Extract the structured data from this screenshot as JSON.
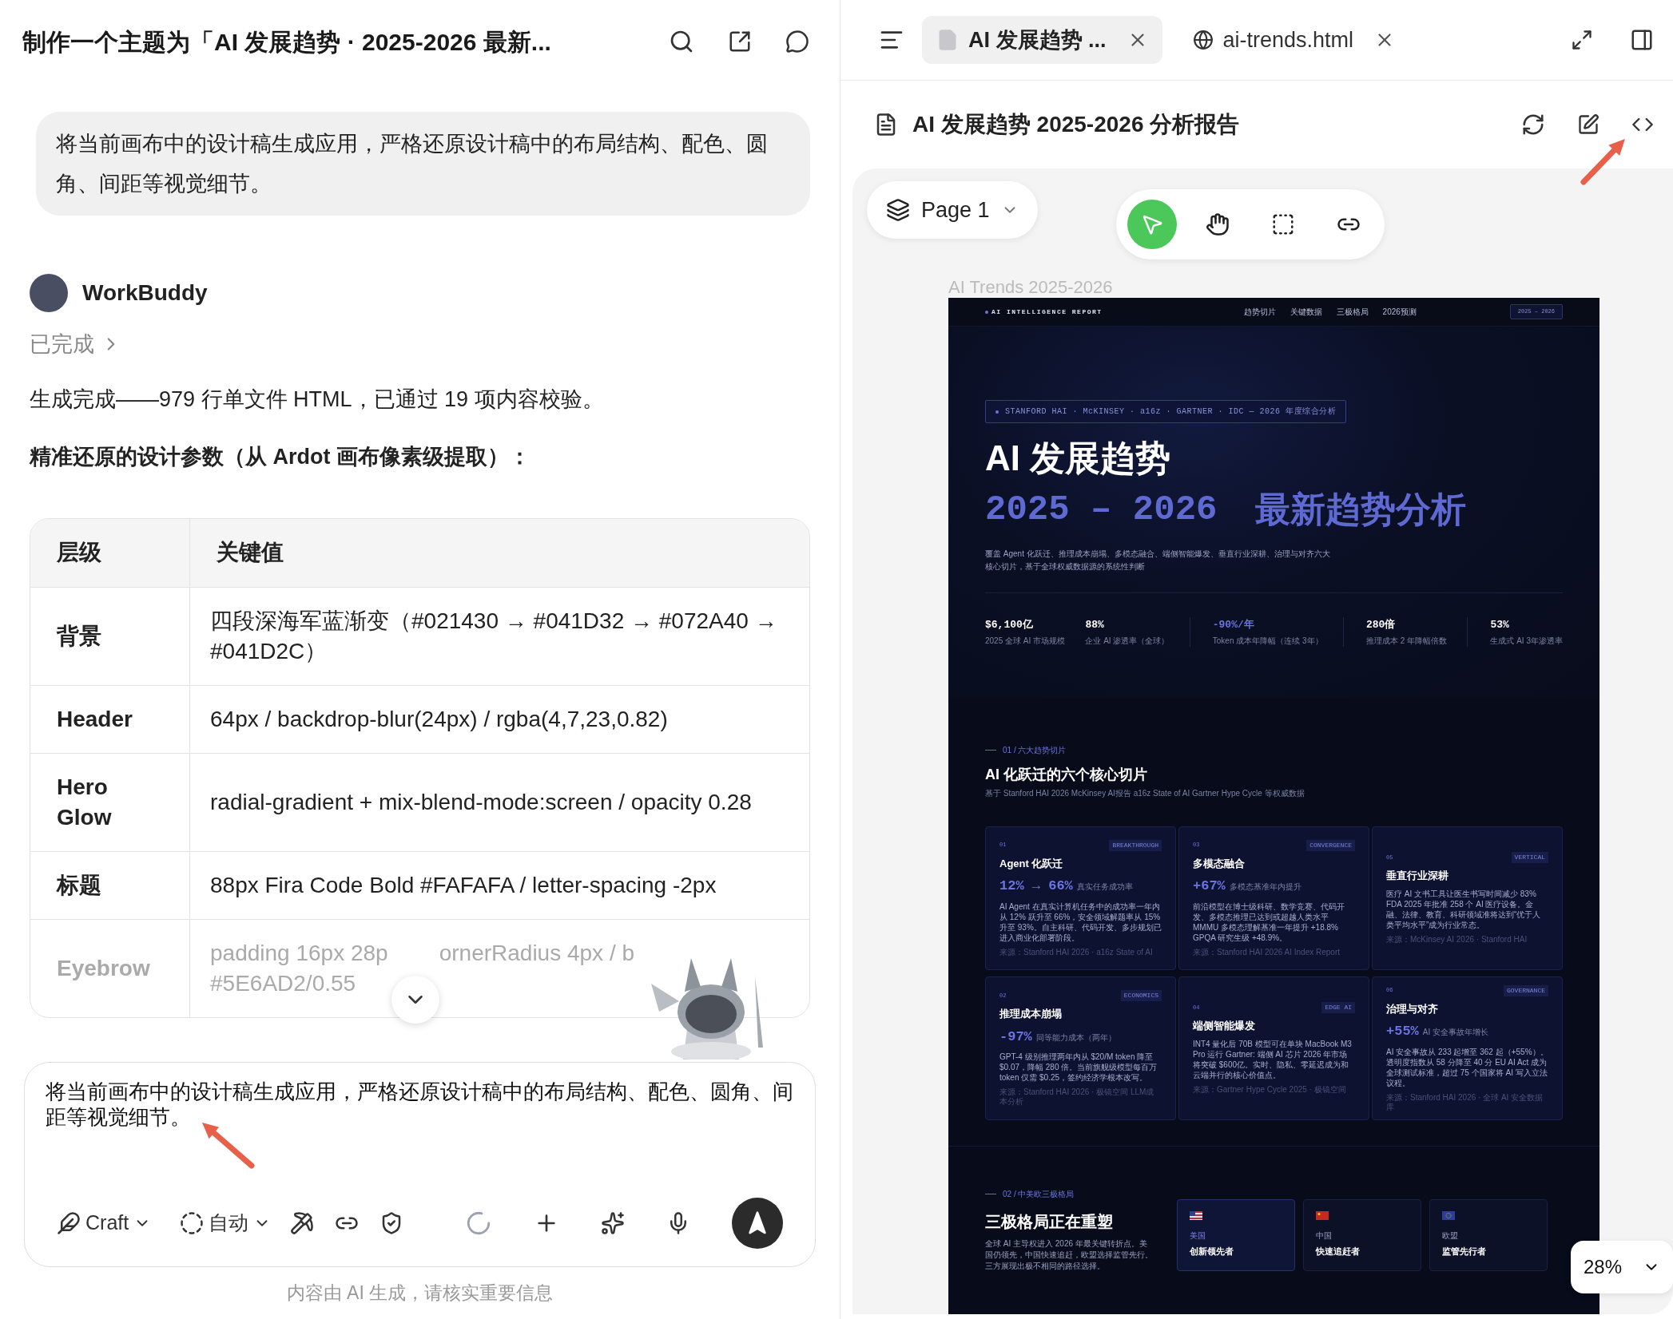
{
  "chat": {
    "title": "制作一个主题为「AI 发展趋势 · 2025-2026 最新...",
    "user_message": "将当前画布中的设计稿生成应用，严格还原设计稿中的布局结构、配色、圆角、间距等视觉细节。",
    "assistant": {
      "name": "WorkBuddy",
      "status": "已完成",
      "summary": "生成完成——979 行单文件 HTML，已通过 19 项内容校验。",
      "heading": "精准还原的设计参数（从 Ardot 画布像素级提取）："
    },
    "table": {
      "columns": [
        "层级",
        "关键值"
      ],
      "rows": [
        {
          "kind": "full",
          "label": "背景",
          "value": "四段深海军蓝渐变（#021430 → #041D32 → #072A40 → #041D2C）"
        },
        {
          "kind": "full",
          "label": "Header",
          "value": "64px / backdrop-blur(24px) / rgba(4,7,23,0.82)"
        },
        {
          "kind": "full",
          "label": "Hero Glow",
          "value": "radial-gradient + mix-blend-mode:screen / opacity 0.28"
        },
        {
          "kind": "full",
          "label": "标题",
          "value": "88px Fira Code Bold #FAFAFA / letter-spacing -2px"
        },
        {
          "kind": "partial",
          "label": "Eyebrow",
          "value_parts": [
            "padding 16px 28p",
            "ornerRadius 4px / b",
            "#5E6AD2/0.55"
          ]
        }
      ]
    },
    "input": {
      "value": "将当前画布中的设计稿生成应用，严格还原设计稿中的布局结构、配色、圆角、间距等视觉细节。"
    },
    "toolbar": {
      "mode": "Craft",
      "model": "自动"
    },
    "footer": "内容由 AI 生成，请核实重要信息"
  },
  "preview_panel": {
    "tabs": [
      {
        "label": "AI 发展趋势 ...",
        "kind": "doc",
        "selected": true
      },
      {
        "label": "ai-trends.html",
        "kind": "web",
        "selected": false
      }
    ],
    "doc_title": "AI 发展趋势 2025-2026 分析报告",
    "page": "Page 1",
    "tools": [
      {
        "kind": "pointer",
        "selected": true
      },
      {
        "kind": "hand",
        "selected": false
      },
      {
        "kind": "frame",
        "selected": false
      },
      {
        "kind": "link",
        "selected": false
      }
    ],
    "frame_label": "AI Trends 2025-2026",
    "zoom": "28%"
  },
  "report": {
    "nav": {
      "brand": "AI INTELLIGENCE REPORT",
      "links": [
        "趋势切片",
        "关键数据",
        "三极格局",
        "2026预测"
      ],
      "badge": "2025 – 2026"
    },
    "hero": {
      "eyebrow": "STANFORD HAI · McKINSEY · a16z · GARTNER · IDC — 2026 年度综合分析",
      "title": "AI 发展趋势",
      "years": "2025 – 2026",
      "subtitle": "最新趋势分析",
      "description": "覆盖 Agent 化跃迁、推理成本崩塌、多模态融合、端侧智能爆发、垂直行业深耕、治理与对齐六大核心切片，基于全球权威数据源的系统性判断",
      "stats": [
        {
          "value": "$6,100亿",
          "label": "2025 全球 AI 市场规模",
          "accent": false
        },
        {
          "value": "88%",
          "label": "企业 AI 渗透率（全球）",
          "accent": false
        },
        {
          "value": "-90%/年",
          "label": "Token 成本年降幅（连续 3年）",
          "accent": true
        },
        {
          "value": "280倍",
          "label": "推理成本 2 年降幅倍数",
          "accent": false
        },
        {
          "value": "53%",
          "label": "生成式 AI 3年渗透率",
          "accent": false
        }
      ]
    },
    "trends": {
      "label": "01 / 六大趋势切片",
      "title": "AI 化跃迁的六个核心切片",
      "subtitle": "基于 Stanford HAI 2026  McKinsey AI报告  a16z State of AI  Gartner Hype Cycle 等权威数据",
      "cards": [
        {
          "number": "01",
          "tag": "BREAKTHROUGH",
          "title": "Agent 化跃迁",
          "metric": "12% → 66%",
          "metric_note": "真实任务成功率",
          "text": "AI Agent 在真实计算机任务中的成功率一年内从 12% 跃升至 66%，安全领域解题率从 15% 升至 93%。自主科研、代码开发、多步规划已进入商业化部署阶段。",
          "source": "来源：Stanford HAI 2026 · a16z State of AI"
        },
        {
          "number": "03",
          "tag": "CONVERGENCE",
          "title": "多模态融合",
          "metric": "+67%",
          "metric_note": "多模态基准年内提升",
          "text": "前沿模型在博士级科研、数学竞赛、代码开发、多模态推理已达到或超越人类水平  MMMU 多模态理解基准一年提升 +18.8%  GPQA 研究生级 +48.9%。",
          "source": "来源：Stanford HAI 2026 AI Index Report"
        },
        {
          "number": "05",
          "tag": "VERTICAL",
          "title": "垂直行业深耕",
          "text": "医疗 AI 文书工具让医生书写时间减少 83%  FDA 2025 年批准 258 个 AI 医疗设备。金融、法律、教育、科研领域准将达到“优于人类平均水平”成为行业常态。",
          "source": "来源：McKinsey AI 2026 · Stanford HAI"
        },
        {
          "number": "02",
          "tag": "ECONOMICS",
          "title": "推理成本崩塌",
          "metric": "-97%",
          "metric_note": "同等能力成本（两年）",
          "text": "GPT-4 级别推理两年内从 $20/M token 降至 $0.07，降幅 280 倍。当前旗舰级模型每百万 token 仅需 $0.25，签约经济学根本改写。",
          "source": "来源：Stanford HAI 2026 · 极镜空间 LLM成本分析"
        },
        {
          "number": "04",
          "tag": "EDGE AI",
          "title": "端侧智能爆发",
          "text": "INT4 量化后 70B 模型可在单块 MacBook M3 Pro 运行  Gartner: 端侧 AI 芯片 2026 年市场将突破 $600亿。实时、隐私、零延迟成为和云端并行的核心价值点。",
          "source": "来源：Gartner Hype Cycle 2025 · 极镜空间"
        },
        {
          "number": "06",
          "tag": "GOVERNANCE",
          "title": "治理与对齐",
          "metric": "+55%",
          "metric_note": "AI 安全事故年增长",
          "text": "AI 安全事故从 233 起增至 362 起（+55%）。透明度指数从 58 分降至 40 分  EU AI Act 成为全球测试标准，超过 75 个国家将 AI 写入立法议程。",
          "source": "来源：Stanford HAI 2026 · 全球 AI 安全数据库"
        }
      ]
    },
    "regions": {
      "label": "02 / 中美欧三极格局",
      "title": "三极格局正在重塑",
      "description": "全球 AI 主导权进入 2026 年最关键转折点。美国仍领先，中国快速追赶，欧盟选择监管先行。三方展现出极不相同的路径选择。",
      "cards": [
        {
          "kind": "us",
          "region": "美国",
          "role": "创新领先者",
          "highlighted": true
        },
        {
          "kind": "cn",
          "region": "中国",
          "role": "快速追赶者",
          "highlighted": false
        },
        {
          "kind": "eu",
          "region": "欧盟",
          "role": "监管先行者",
          "highlighted": false
        }
      ]
    }
  }
}
